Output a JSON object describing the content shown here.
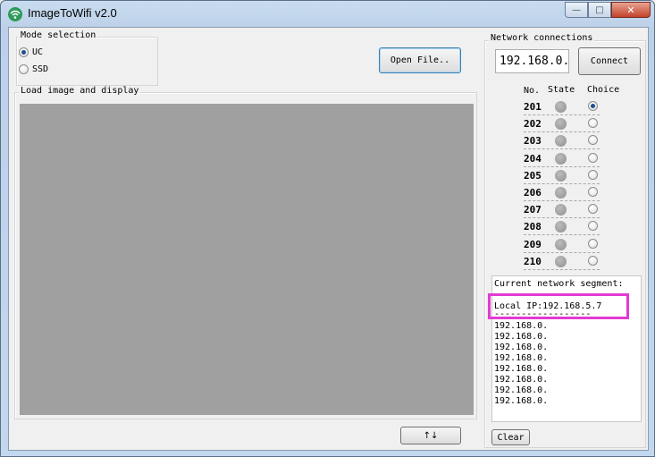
{
  "window": {
    "title": "ImageToWifi v2.0",
    "controls": {
      "minimize": "—",
      "maximize": "□",
      "close": "✕"
    }
  },
  "mode": {
    "label": "Mode selection",
    "options": [
      {
        "label": "UC",
        "selected": true
      },
      {
        "label": "SSD",
        "selected": false
      }
    ]
  },
  "open_file_button": "Open File..",
  "display_group_label": "Load image and display",
  "move_button": "↑↓",
  "network": {
    "label": "Network connections",
    "ip_value": "192.168.0.",
    "connect_button": "Connect",
    "columns": {
      "no": "No.",
      "state": "State",
      "choice": "Choice"
    },
    "rows": [
      {
        "no": "201",
        "selected": true
      },
      {
        "no": "202",
        "selected": false
      },
      {
        "no": "203",
        "selected": false
      },
      {
        "no": "204",
        "selected": false
      },
      {
        "no": "205",
        "selected": false
      },
      {
        "no": "206",
        "selected": false
      },
      {
        "no": "207",
        "selected": false
      },
      {
        "no": "208",
        "selected": false
      },
      {
        "no": "209",
        "selected": false
      },
      {
        "no": "210",
        "selected": false
      }
    ]
  },
  "log": {
    "title": "Current network segment:",
    "local_ip": "Local IP:192.168.5.7",
    "rule": "------------------",
    "lines": [
      "192.168.0.",
      "192.168.0.",
      "192.168.0.",
      "192.168.0.",
      "192.168.0.",
      "192.168.0.",
      "192.168.0.",
      "192.168.0."
    ]
  },
  "clear_button": "Clear",
  "colors": {
    "highlight": "#e23ad4",
    "display_bg": "#a0a0a0",
    "radio_on": "#1f4f8f"
  },
  "icons": {
    "app": "wifi-icon"
  }
}
